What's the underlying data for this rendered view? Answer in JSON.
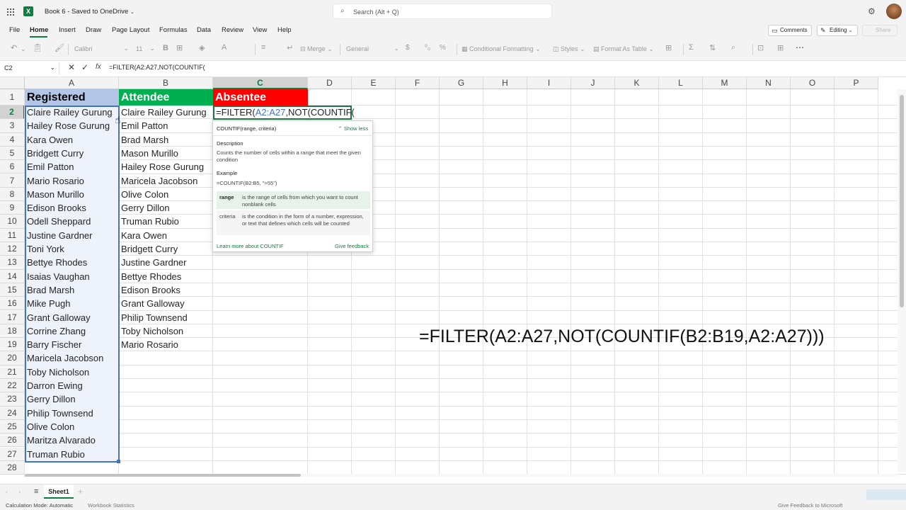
{
  "app": {
    "doc_title": "Book 6 - Saved to OneDrive",
    "search_placeholder": "Search (Alt + Q)"
  },
  "menu": [
    "File",
    "Home",
    "Insert",
    "Draw",
    "Page Layout",
    "Formulas",
    "Data",
    "Review",
    "View",
    "Help"
  ],
  "menu_active": "Home",
  "topright": {
    "comments": "Comments",
    "editing": "Editing",
    "share": "Share"
  },
  "ribbon": {
    "font": "Calibri",
    "size": "11",
    "merge": "Merge",
    "number_format": "General",
    "conditional": "Conditional Formatting",
    "styles": "Styles",
    "format_table": "Format As Table"
  },
  "formula_bar": {
    "name_box": "C2",
    "formula": "=FILTER(A2:A27,NOT(COUNTIF("
  },
  "columns": [
    "A",
    "B",
    "C",
    "D",
    "E",
    "F",
    "G",
    "H",
    "I",
    "J",
    "K",
    "L",
    "M",
    "N",
    "O",
    "P"
  ],
  "rows": [
    "1",
    "2",
    "3",
    "4",
    "5",
    "6",
    "7",
    "8",
    "9",
    "10",
    "11",
    "12",
    "13",
    "14",
    "15",
    "16",
    "17",
    "18",
    "19",
    "20",
    "21",
    "22",
    "23",
    "24",
    "25",
    "26",
    "27",
    "28"
  ],
  "headers": {
    "registered": "Registered",
    "attendee": "Attendee",
    "absentee": "Absentee"
  },
  "registered": [
    "Claire Railey Gurung",
    "Hailey Rose Gurung",
    "Kara Owen",
    "Bridgett Curry",
    "Emil Patton",
    "Mario Rosario",
    "Mason Murillo",
    "Edison Brooks",
    "Odell Sheppard",
    "Justine Gardner",
    "Toni York",
    "Bettye Rhodes",
    "Isaias Vaughan",
    "Brad Marsh",
    "Mike Pugh",
    "Grant Galloway",
    "Corrine Zhang",
    "Barry Fischer",
    "Maricela Jacobson",
    "Toby Nicholson",
    "Darron Ewing",
    "Gerry Dillon",
    "Philip Townsend",
    "Olive Colon",
    "Maritza Alvarado",
    "Truman Rubio"
  ],
  "attendee": [
    "Claire Railey Gurung",
    "Emil Patton",
    "Brad Marsh",
    "Mason Murillo",
    "Hailey Rose Gurung",
    "Maricela Jacobson",
    "Olive Colon",
    "Gerry Dillon",
    "Truman Rubio",
    "Kara Owen",
    "Bridgett Curry",
    "Justine Gardner",
    "Bettye Rhodes",
    "Edison Brooks",
    "Grant Galloway",
    "Philip Townsend",
    "Toby Nicholson",
    "Mario Rosario"
  ],
  "editing_cell": {
    "prefix": "=FILTER(",
    "ref": "A2:A27",
    "suffix": ",NOT(COUNTIF("
  },
  "tooltip": {
    "signature_fn": "COUNTIF",
    "signature_args": "(range, criteria)",
    "show_less": "Show less",
    "description_label": "Description",
    "description": "Counts the number of cells within a range that meet the given condition",
    "example_label": "Example",
    "example": "=COUNTIF(B2:B5, \">55\")",
    "params": [
      {
        "name": "range",
        "desc": "is the range of cells from which you want to count nonblank cells"
      },
      {
        "name": "criteria",
        "desc": "is the condition in the form of a number, expression, or text that defines which cells will be counted"
      }
    ],
    "learn_more": "Learn more about COUNTIF",
    "feedback": "Give feedback"
  },
  "overlay_formula": "=FILTER(A2:A27,NOT(COUNTIF(B2:B19,A2:A27)))",
  "sheet_tab": "Sheet1",
  "status": {
    "calc_mode": "Calculation Mode: Automatic",
    "workbook_stats": "Workbook Statistics",
    "feedback": "Give Feedback to Microsoft"
  },
  "colors": {
    "registered_header": "#b4c6e7",
    "registered_fill": "#d9e1f2",
    "attendee_header": "#00b050",
    "absentee_header": "#ff0000",
    "excel_green": "#107c41",
    "selection_blue": "#4472c4"
  }
}
